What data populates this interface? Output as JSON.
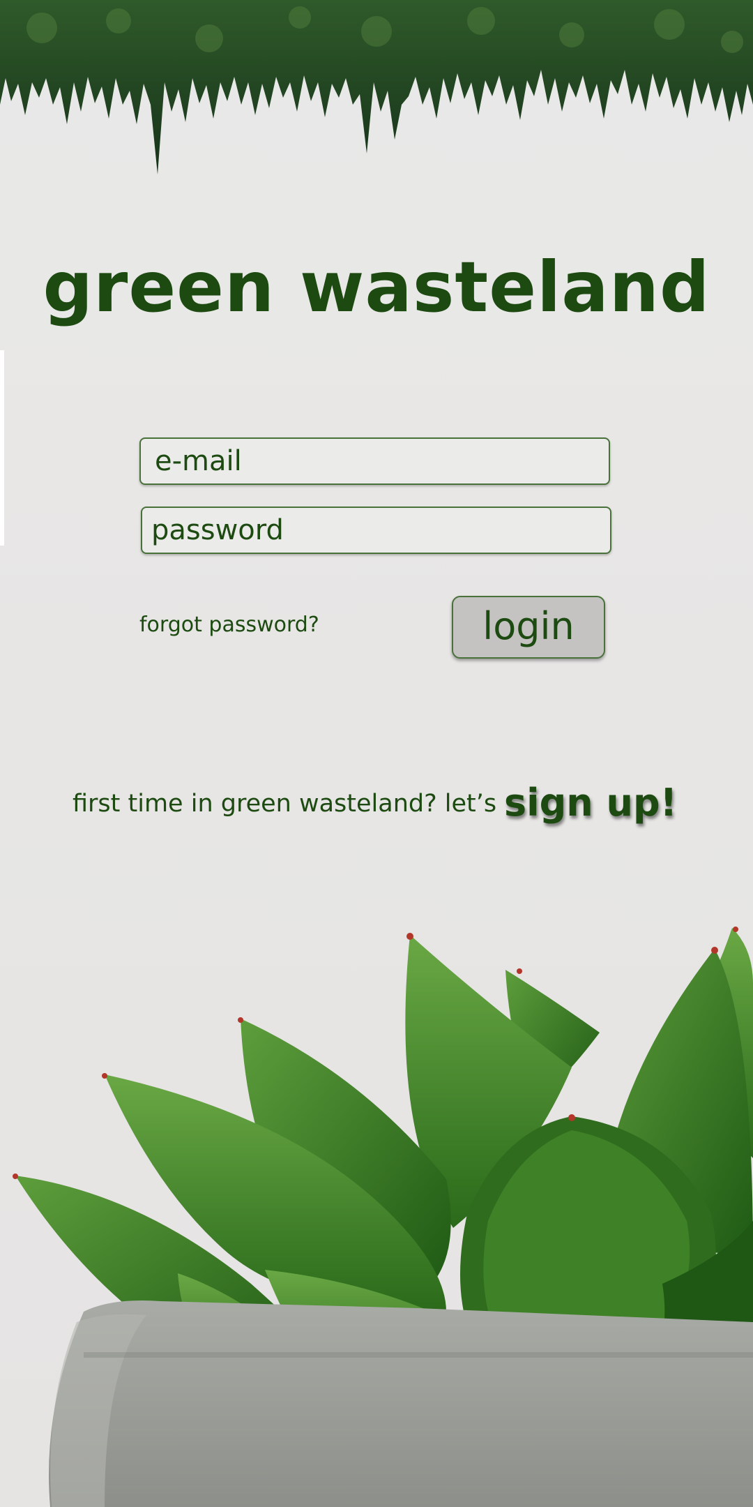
{
  "app": {
    "title": "green wasteland"
  },
  "login_form": {
    "email_placeholder": "e-mail",
    "password_placeholder": "password",
    "forgot_label": "forgot password?",
    "login_label": "login"
  },
  "signup": {
    "prompt": "first time in green wasteland? let’s",
    "link_label": "sign up!"
  },
  "colors": {
    "brand_green": "#1c4a10",
    "field_border": "#49713a",
    "button_fill": "#c4c3c2",
    "background": "#e8e7e6"
  },
  "images": {
    "header": "forest-trees-hanging-photo",
    "footer": "succulent-in-concrete-pot-photo"
  }
}
